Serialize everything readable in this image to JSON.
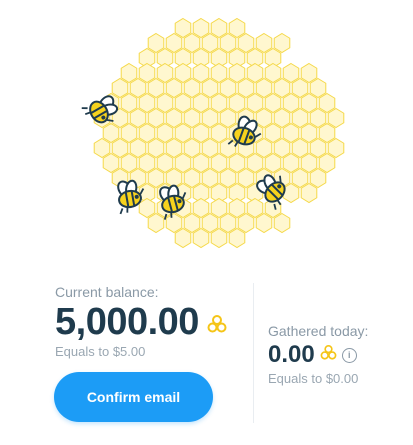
{
  "colors": {
    "accent": "#1c9cf6",
    "honey_fill": "#fff7cf",
    "honey_stroke": "#f5d94a",
    "bee_yellow": "#f6d21d",
    "bee_dark": "#1f3b4d"
  },
  "illustration": {
    "icon": "honeycomb-with-bees"
  },
  "balance": {
    "label": "Current balance:",
    "amount": "5,000.00",
    "equals": "Equals to $5.00",
    "icon": "honey-drops-icon"
  },
  "gathered": {
    "label": "Gathered today:",
    "amount": "0.00",
    "equals": "Equals to $0.00",
    "icon": "honey-drops-icon",
    "info_icon": "info-icon",
    "info_glyph": "i"
  },
  "actions": {
    "confirm_email": "Confirm email"
  }
}
